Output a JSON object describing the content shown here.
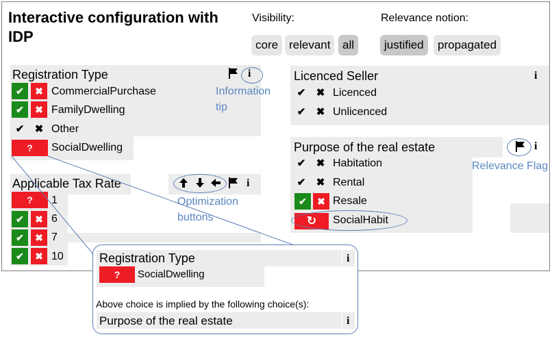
{
  "title": "Interactive configuration with IDP",
  "visibility": {
    "label": "Visibility:",
    "options": [
      "core",
      "relevant",
      "all"
    ],
    "selected": "all"
  },
  "relevance": {
    "label": "Relevance notion:",
    "options": [
      "justified",
      "propagated"
    ],
    "selected": "justified"
  },
  "registration": {
    "title": "Registration Type",
    "options": [
      "CommercialPurchase",
      "FamilyDwelling",
      "Other",
      "SocialDwelling"
    ],
    "unknown_symbol": "?"
  },
  "tax": {
    "title": "Applicable Tax Rate",
    "options": [
      "1",
      "6",
      "7",
      "10"
    ],
    "unknown_symbol": "?"
  },
  "seller": {
    "title": "Licenced Seller",
    "options": [
      "Licenced",
      "Unlicenced"
    ]
  },
  "purpose": {
    "title": "Purpose of the real estate",
    "options": [
      "Habitation",
      "Rental",
      "Resale",
      "SocialHabit"
    ]
  },
  "annotations": {
    "info_tip": "Information tip",
    "optimization": "Optimization buttons",
    "relevance_flag": "Relevance Flag"
  },
  "popup": {
    "title": "Registration Type",
    "value": "SocialDwelling",
    "unknown_symbol": "?",
    "message": "Above choice is implied by the following choice(s):",
    "implied_by": "Purpose of the real estate"
  },
  "icons": {
    "info": "i",
    "check": "✔",
    "cross": "✖",
    "flag": "flag-icon",
    "undo": "↻"
  },
  "colors": {
    "green": "#1a8a1a",
    "red": "#ee1c24",
    "annotation": "#5b87c0"
  }
}
